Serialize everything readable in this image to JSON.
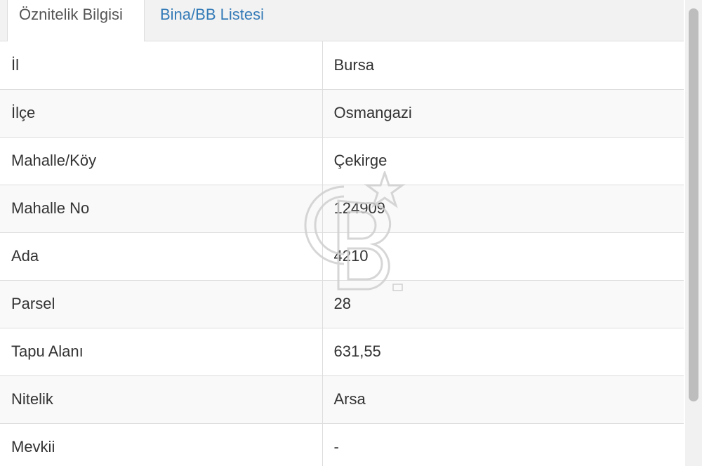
{
  "tabs": [
    {
      "label": "Öznitelik Bilgisi",
      "active": true
    },
    {
      "label": "Bina/BB Listesi",
      "active": false
    }
  ],
  "attributes": [
    {
      "key": "İl",
      "value": "Bursa"
    },
    {
      "key": "İlçe",
      "value": "Osmangazi"
    },
    {
      "key": "Mahalle/Köy",
      "value": "Çekirge"
    },
    {
      "key": "Mahalle No",
      "value": "124909"
    },
    {
      "key": "Ada",
      "value": "4210"
    },
    {
      "key": "Parsel",
      "value": "28"
    },
    {
      "key": "Tapu Alanı",
      "value": "631,55"
    },
    {
      "key": "Nitelik",
      "value": "Arsa"
    },
    {
      "key": "Mevkii",
      "value": "-"
    }
  ],
  "watermark": {
    "name": "cb-logo-watermark",
    "text": "CB",
    "mark": "SM"
  },
  "colors": {
    "link": "#337ab7",
    "border": "#dddddd",
    "stripe": "#f9f9f9",
    "tabbar": "#f2f2f2"
  }
}
